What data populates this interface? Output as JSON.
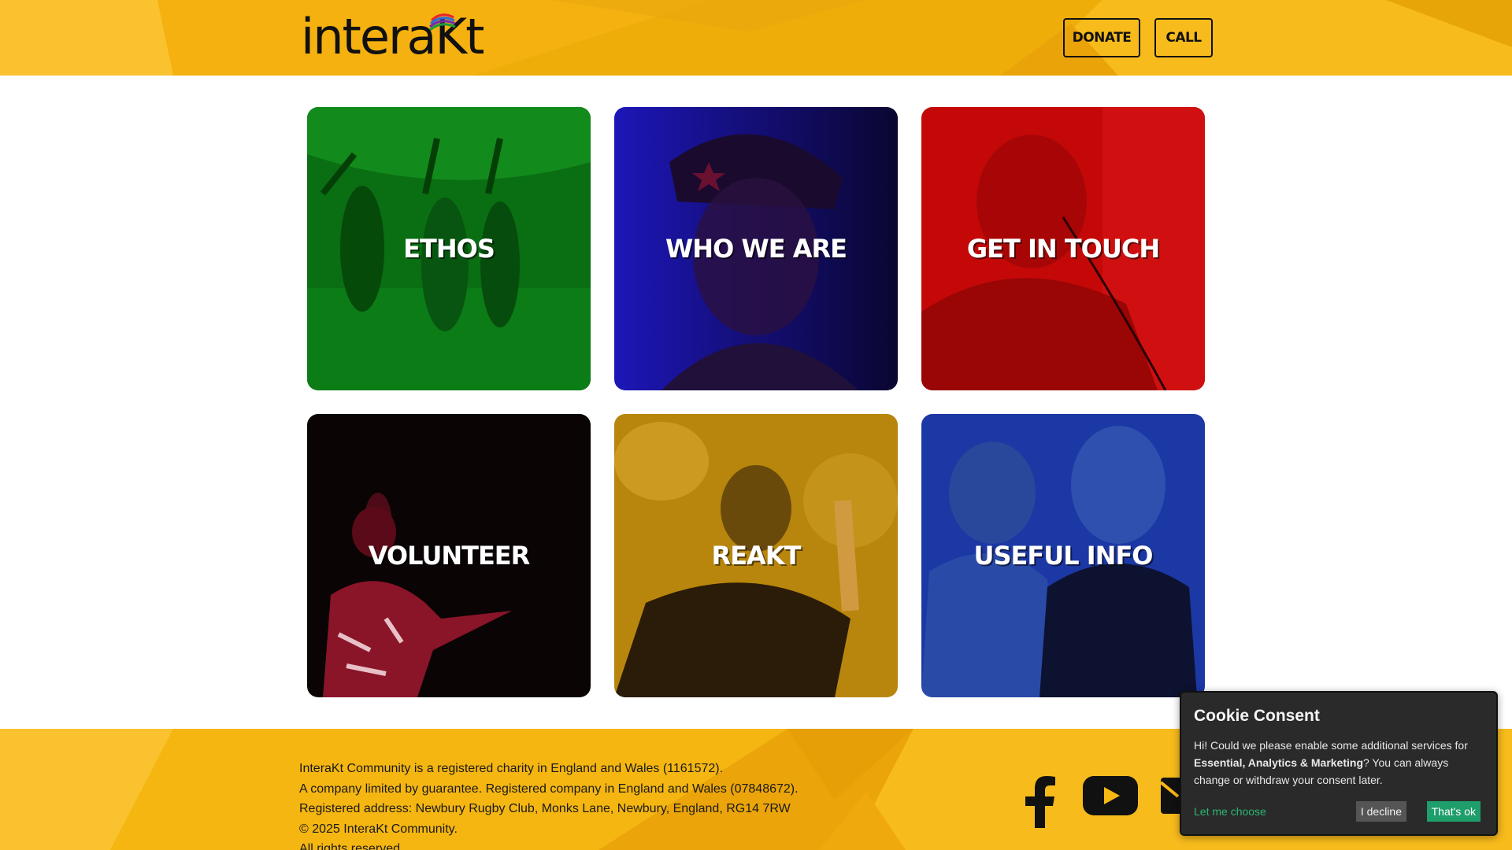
{
  "header": {
    "logo_text": "interaKt",
    "donate_label": "DONATE",
    "call_label": "CALL"
  },
  "tiles": [
    {
      "label": "ETHOS",
      "tint": "#0a7a14"
    },
    {
      "label": "WHO WE ARE",
      "tint": "#1a14a8"
    },
    {
      "label": "GET IN TOUCH",
      "tint": "#c80a0a"
    },
    {
      "label": "VOLUNTEER",
      "tint": "#0a0405"
    },
    {
      "label": "REAKT",
      "tint": "#b9860c"
    },
    {
      "label": "USEFUL INFO",
      "tint": "#1a3aa8"
    }
  ],
  "footer": {
    "line1": "InteraKt Community is a registered charity in England and Wales (1161572).",
    "line2": "A company limited by guarantee. Registered company in England and Wales (07848672).",
    "line3": "Registered address: Newbury Rugby Club, Monks Lane, Newbury, England, RG14 7RW",
    "line4": "© 2025 InteraKt Community.",
    "line5": "All rights reserved"
  },
  "social": [
    "facebook-icon",
    "youtube-icon",
    "email-icon"
  ],
  "cookie": {
    "title": "Cookie Consent",
    "text_before": "Hi! Could we please enable some additional services for ",
    "text_bold": "Essential, Analytics & Marketing",
    "text_after": "? You can always change or withdraw your consent later.",
    "let_me_choose": "Let me choose",
    "decline": "I decline",
    "accept": "That's ok"
  },
  "colors": {
    "brand_yellow": "#f7b814",
    "cookie_accent": "#1e9e6a"
  }
}
